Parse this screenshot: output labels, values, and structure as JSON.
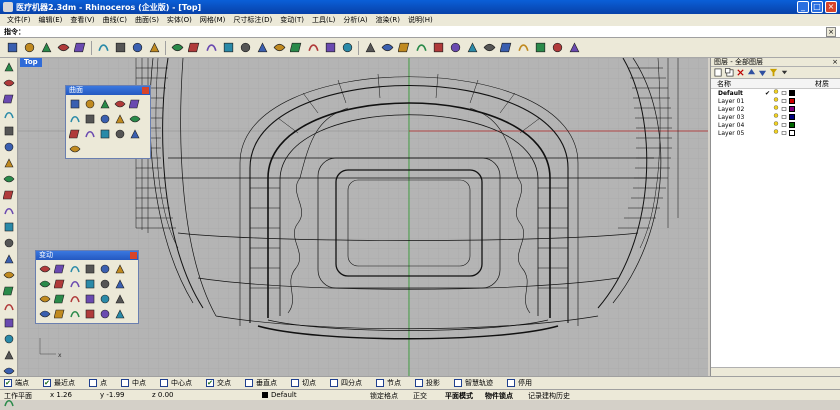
{
  "window": {
    "title": "医疗机器2.3dm - Rhinoceros (企业版) - [Top]"
  },
  "menu": [
    "文件(F)",
    "编辑(E)",
    "查看(V)",
    "曲线(C)",
    "曲面(S)",
    "实体(O)",
    "网格(M)",
    "尺寸标注(D)",
    "变动(T)",
    "工具(L)",
    "分析(A)",
    "渲染(R)",
    "说明(H)"
  ],
  "command": {
    "label": "指令：",
    "value": "",
    "close": "×"
  },
  "toolbar_icons": [
    "new-file-icon",
    "open-folder-icon",
    "save-icon",
    "print-icon",
    "import-icon",
    "cut-icon",
    "copy-icon",
    "paste-icon",
    "undo-icon",
    "pan-hand-icon",
    "rotate-view-icon",
    "zoom-icon",
    "zoom-window-icon",
    "zoom-extents-icon",
    "zoom-selected-icon",
    "zoom-all-icon",
    "front-view-icon",
    "pan-icon",
    "orbit-icon",
    "grid-icon",
    "capture-icon",
    "sun-icon",
    "light-bulb-icon",
    "lock-icon",
    "wireframe-icon",
    "color-wheel-icon",
    "render-sphere-icon",
    "shaded-sphere-icon",
    "material-icon",
    "globe-icon",
    "settings-gear-icon",
    "network-icon",
    "help-icon"
  ],
  "left_tools": [
    "select-arrow-icon",
    "polyline-icon",
    "circle-icon",
    "arc-icon",
    "ellipse-icon",
    "curve-icon",
    "surface-icon",
    "box-icon",
    "cylinder-icon",
    "extrude-icon",
    "fillet-icon",
    "trim-icon",
    "boolean-icon",
    "revolve-icon",
    "sweep-icon",
    "transform-icon",
    "move-icon",
    "point-icon",
    "dimension-icon",
    "layer-icon",
    "rectangle-icon",
    "polygon-icon"
  ],
  "viewport": {
    "name": "Top",
    "axis_label": "x"
  },
  "surface_palette": {
    "title": "曲面",
    "icons": [
      "plane-surface-icon",
      "edge-surface-icon",
      "sphere-surface-icon",
      "rect-surface-icon",
      "loft-icon",
      "patch-icon",
      "network-surface-icon",
      "rail-revolve-icon",
      "sweep1-icon",
      "sweep2-icon",
      "blend-surface-icon",
      "offset-surface-icon",
      "extrude-surface-icon",
      "revolve-surface-icon",
      "fillet-surface-icon",
      "drape-icon"
    ]
  },
  "transform_palette": {
    "title": "变动",
    "icons": [
      "move-icon",
      "copy-object-icon",
      "rotate-icon",
      "scale-icon",
      "mirror-icon",
      "array-icon",
      "orient-icon",
      "twist-icon",
      "bend-icon",
      "taper-icon",
      "flow-icon",
      "project-icon",
      "align-icon",
      "shear-icon",
      "stretch-icon",
      "smooth-icon",
      "set-points-icon",
      "splop-icon",
      "rotate3d-icon",
      "scale1d-icon",
      "scale2d-icon",
      "array-polar-icon",
      "array-curve-icon",
      "remap-icon"
    ]
  },
  "layers_panel": {
    "title": "图层 - 全部图层",
    "close": "×",
    "columns": {
      "name": "名称",
      "material": "材质"
    },
    "rows": [
      {
        "name": "Default",
        "current": true,
        "check": "✔",
        "color": "#000000"
      },
      {
        "name": "Layer 01",
        "current": false,
        "check": "",
        "color": "#cc0000"
      },
      {
        "name": "Layer 02",
        "current": false,
        "check": "",
        "color": "#800080"
      },
      {
        "name": "Layer 03",
        "current": false,
        "check": "",
        "color": "#000080"
      },
      {
        "name": "Layer 04",
        "current": false,
        "check": "",
        "color": "#006600"
      },
      {
        "name": "Layer 05",
        "current": false,
        "check": "",
        "color": "#ffffff"
      }
    ]
  },
  "osnaps": [
    {
      "label": "端点",
      "checked": true
    },
    {
      "label": "最近点",
      "checked": true
    },
    {
      "label": "点",
      "checked": false
    },
    {
      "label": "中点",
      "checked": false
    },
    {
      "label": "中心点",
      "checked": false
    },
    {
      "label": "交点",
      "checked": true
    },
    {
      "label": "垂直点",
      "checked": false
    },
    {
      "label": "切点",
      "checked": false
    },
    {
      "label": "四分点",
      "checked": false
    },
    {
      "label": "节点",
      "checked": false
    },
    {
      "label": "投影",
      "checked": false
    },
    {
      "label": "智慧轨迹",
      "checked": false
    },
    {
      "label": "停用",
      "checked": false
    }
  ],
  "status": {
    "cplane": "工作平面",
    "x": "x 1.26",
    "y": "y -1.99",
    "z": "z 0.00",
    "layer": "Default",
    "grid_snap": "锁定格点",
    "ortho": "正交",
    "planar": "平面模式",
    "osnap": "物件锁点",
    "history": "记录建构历史"
  }
}
